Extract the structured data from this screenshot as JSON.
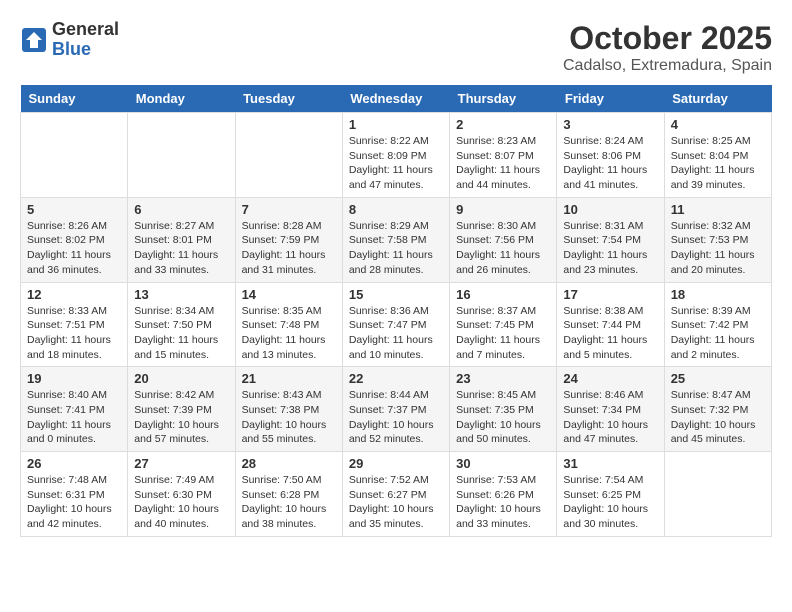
{
  "logo": {
    "general": "General",
    "blue": "Blue"
  },
  "title": "October 2025",
  "subtitle": "Cadalso, Extremadura, Spain",
  "weekdays": [
    "Sunday",
    "Monday",
    "Tuesday",
    "Wednesday",
    "Thursday",
    "Friday",
    "Saturday"
  ],
  "weeks": [
    [
      {
        "day": "",
        "info": ""
      },
      {
        "day": "",
        "info": ""
      },
      {
        "day": "",
        "info": ""
      },
      {
        "day": "1",
        "info": "Sunrise: 8:22 AM\nSunset: 8:09 PM\nDaylight: 11 hours and 47 minutes."
      },
      {
        "day": "2",
        "info": "Sunrise: 8:23 AM\nSunset: 8:07 PM\nDaylight: 11 hours and 44 minutes."
      },
      {
        "day": "3",
        "info": "Sunrise: 8:24 AM\nSunset: 8:06 PM\nDaylight: 11 hours and 41 minutes."
      },
      {
        "day": "4",
        "info": "Sunrise: 8:25 AM\nSunset: 8:04 PM\nDaylight: 11 hours and 39 minutes."
      }
    ],
    [
      {
        "day": "5",
        "info": "Sunrise: 8:26 AM\nSunset: 8:02 PM\nDaylight: 11 hours and 36 minutes."
      },
      {
        "day": "6",
        "info": "Sunrise: 8:27 AM\nSunset: 8:01 PM\nDaylight: 11 hours and 33 minutes."
      },
      {
        "day": "7",
        "info": "Sunrise: 8:28 AM\nSunset: 7:59 PM\nDaylight: 11 hours and 31 minutes."
      },
      {
        "day": "8",
        "info": "Sunrise: 8:29 AM\nSunset: 7:58 PM\nDaylight: 11 hours and 28 minutes."
      },
      {
        "day": "9",
        "info": "Sunrise: 8:30 AM\nSunset: 7:56 PM\nDaylight: 11 hours and 26 minutes."
      },
      {
        "day": "10",
        "info": "Sunrise: 8:31 AM\nSunset: 7:54 PM\nDaylight: 11 hours and 23 minutes."
      },
      {
        "day": "11",
        "info": "Sunrise: 8:32 AM\nSunset: 7:53 PM\nDaylight: 11 hours and 20 minutes."
      }
    ],
    [
      {
        "day": "12",
        "info": "Sunrise: 8:33 AM\nSunset: 7:51 PM\nDaylight: 11 hours and 18 minutes."
      },
      {
        "day": "13",
        "info": "Sunrise: 8:34 AM\nSunset: 7:50 PM\nDaylight: 11 hours and 15 minutes."
      },
      {
        "day": "14",
        "info": "Sunrise: 8:35 AM\nSunset: 7:48 PM\nDaylight: 11 hours and 13 minutes."
      },
      {
        "day": "15",
        "info": "Sunrise: 8:36 AM\nSunset: 7:47 PM\nDaylight: 11 hours and 10 minutes."
      },
      {
        "day": "16",
        "info": "Sunrise: 8:37 AM\nSunset: 7:45 PM\nDaylight: 11 hours and 7 minutes."
      },
      {
        "day": "17",
        "info": "Sunrise: 8:38 AM\nSunset: 7:44 PM\nDaylight: 11 hours and 5 minutes."
      },
      {
        "day": "18",
        "info": "Sunrise: 8:39 AM\nSunset: 7:42 PM\nDaylight: 11 hours and 2 minutes."
      }
    ],
    [
      {
        "day": "19",
        "info": "Sunrise: 8:40 AM\nSunset: 7:41 PM\nDaylight: 11 hours and 0 minutes."
      },
      {
        "day": "20",
        "info": "Sunrise: 8:42 AM\nSunset: 7:39 PM\nDaylight: 10 hours and 57 minutes."
      },
      {
        "day": "21",
        "info": "Sunrise: 8:43 AM\nSunset: 7:38 PM\nDaylight: 10 hours and 55 minutes."
      },
      {
        "day": "22",
        "info": "Sunrise: 8:44 AM\nSunset: 7:37 PM\nDaylight: 10 hours and 52 minutes."
      },
      {
        "day": "23",
        "info": "Sunrise: 8:45 AM\nSunset: 7:35 PM\nDaylight: 10 hours and 50 minutes."
      },
      {
        "day": "24",
        "info": "Sunrise: 8:46 AM\nSunset: 7:34 PM\nDaylight: 10 hours and 47 minutes."
      },
      {
        "day": "25",
        "info": "Sunrise: 8:47 AM\nSunset: 7:32 PM\nDaylight: 10 hours and 45 minutes."
      }
    ],
    [
      {
        "day": "26",
        "info": "Sunrise: 7:48 AM\nSunset: 6:31 PM\nDaylight: 10 hours and 42 minutes."
      },
      {
        "day": "27",
        "info": "Sunrise: 7:49 AM\nSunset: 6:30 PM\nDaylight: 10 hours and 40 minutes."
      },
      {
        "day": "28",
        "info": "Sunrise: 7:50 AM\nSunset: 6:28 PM\nDaylight: 10 hours and 38 minutes."
      },
      {
        "day": "29",
        "info": "Sunrise: 7:52 AM\nSunset: 6:27 PM\nDaylight: 10 hours and 35 minutes."
      },
      {
        "day": "30",
        "info": "Sunrise: 7:53 AM\nSunset: 6:26 PM\nDaylight: 10 hours and 33 minutes."
      },
      {
        "day": "31",
        "info": "Sunrise: 7:54 AM\nSunset: 6:25 PM\nDaylight: 10 hours and 30 minutes."
      },
      {
        "day": "",
        "info": ""
      }
    ]
  ]
}
